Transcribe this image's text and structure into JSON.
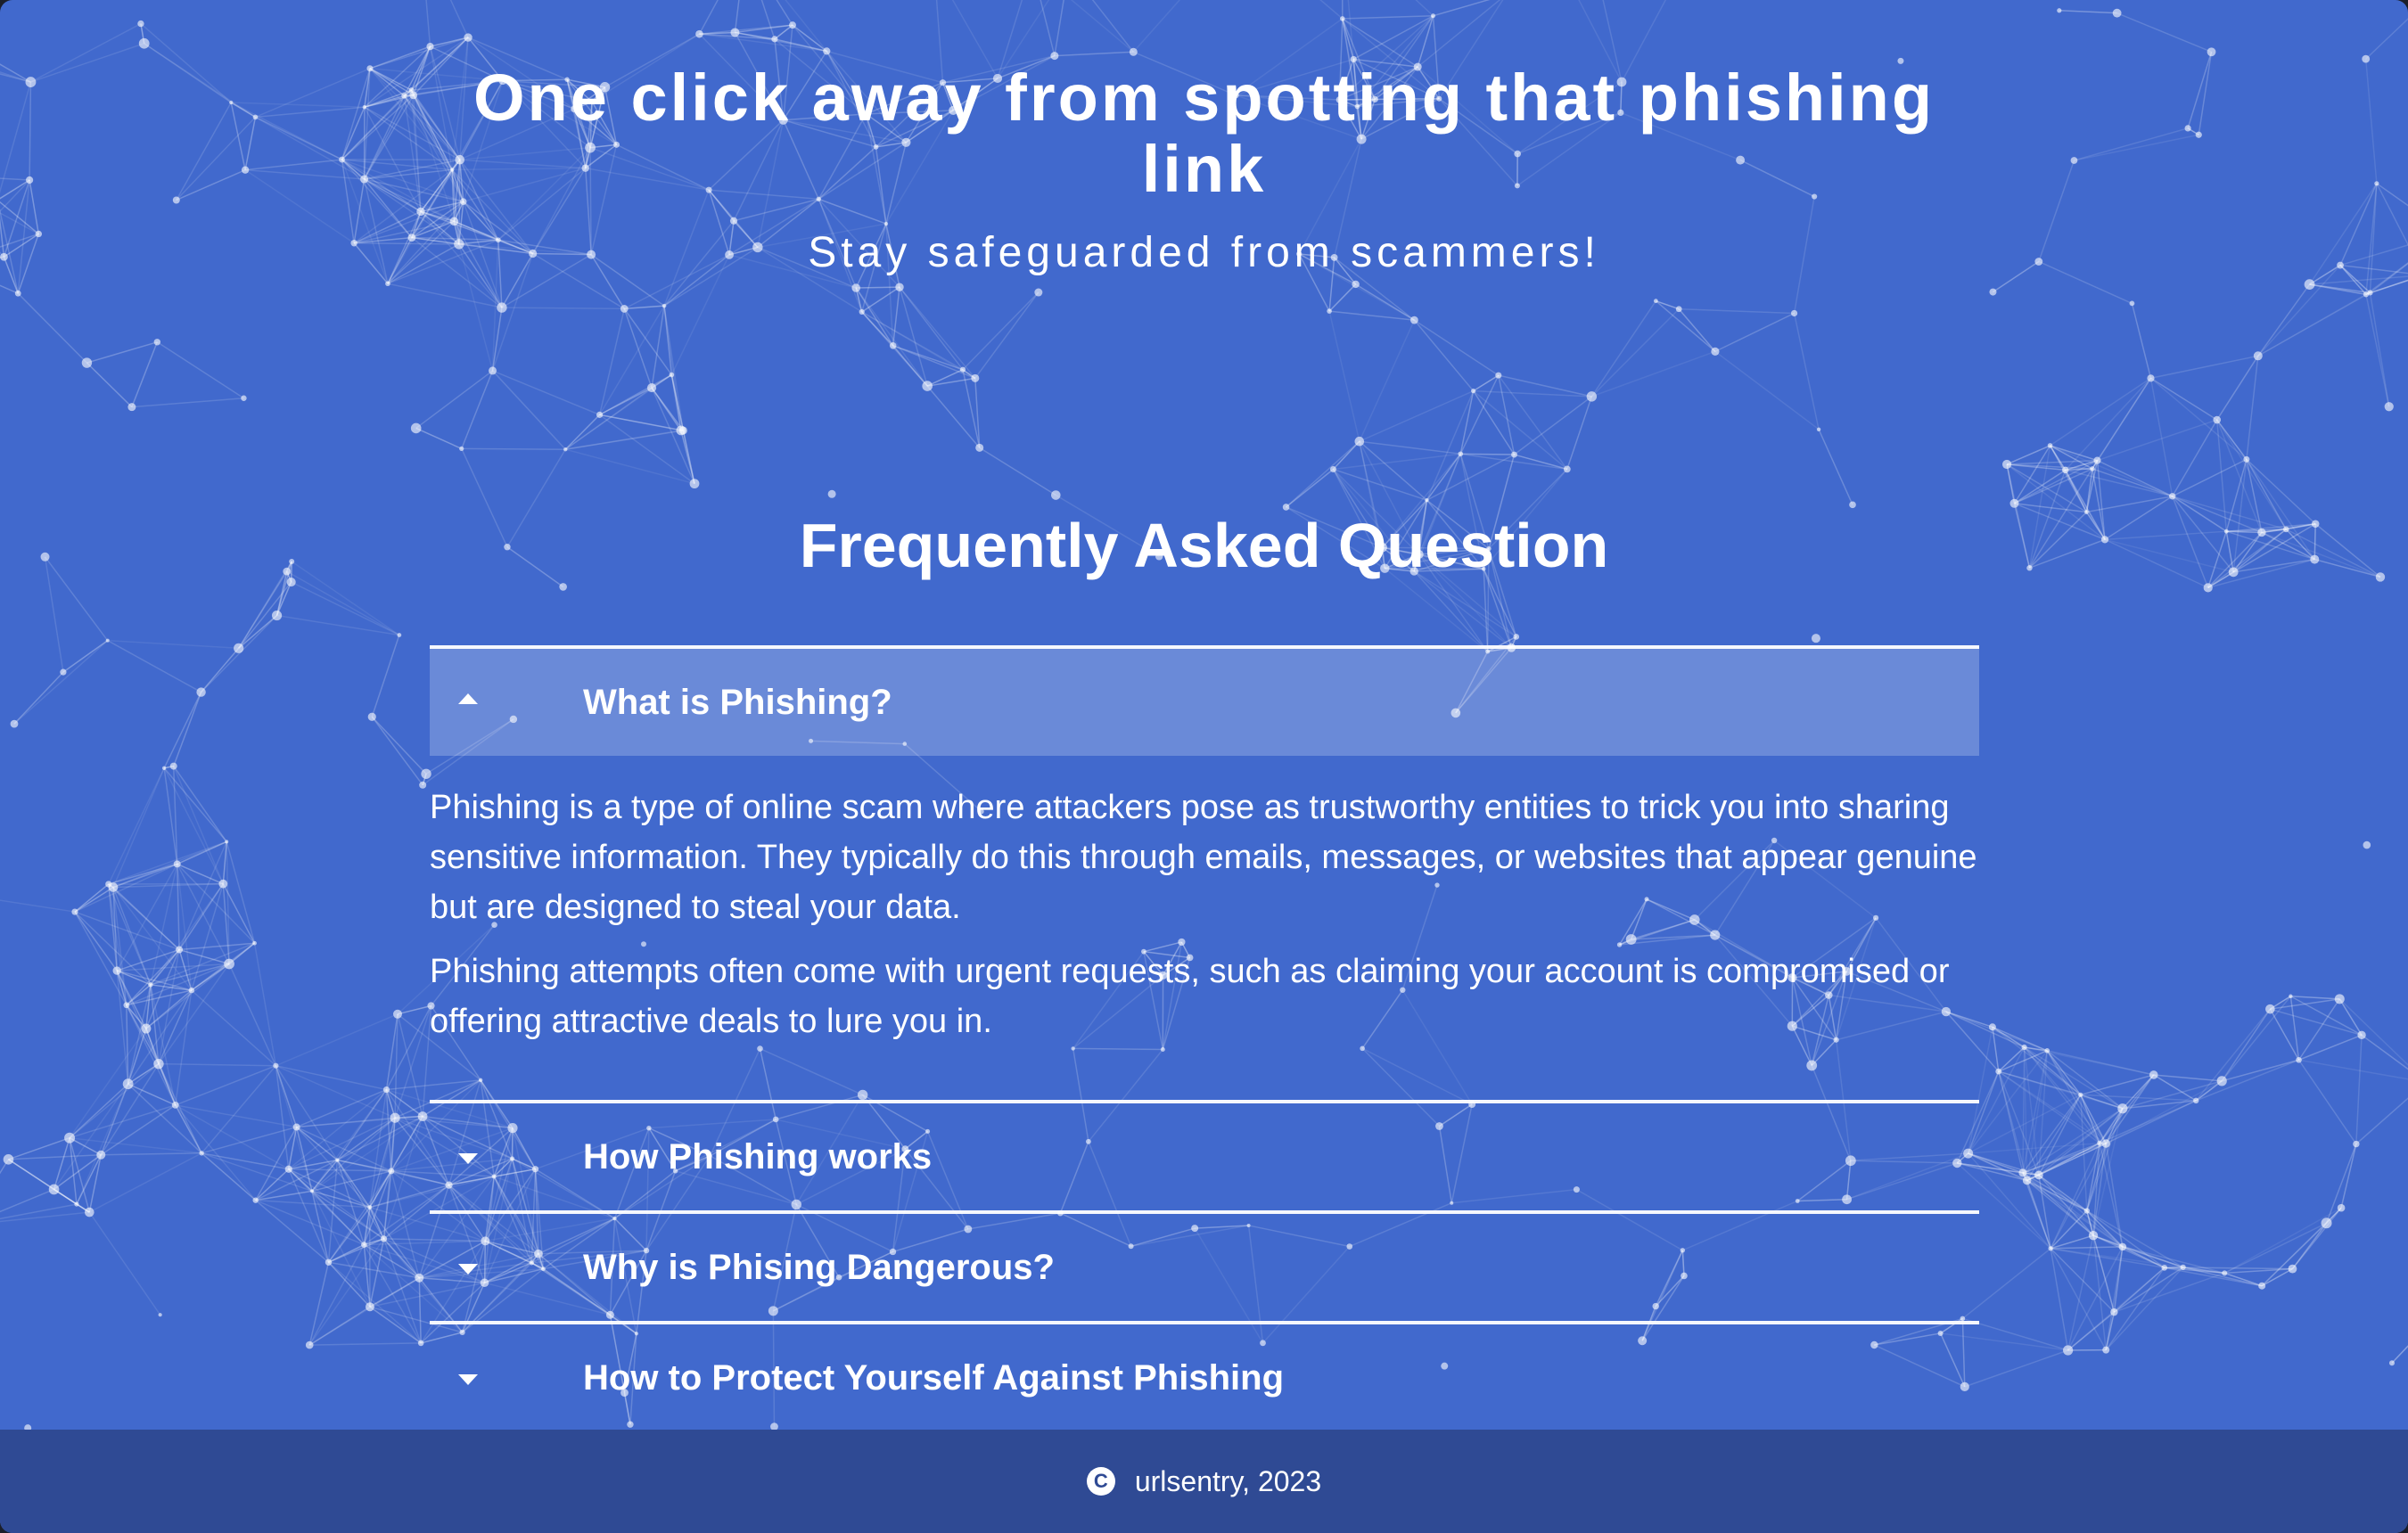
{
  "hero": {
    "title": "One click away from spotting that phishing link",
    "subtitle": "Stay safeguarded from scammers!"
  },
  "faq": {
    "heading": "Frequently Asked Question",
    "items": [
      {
        "question": "What is Phishing?",
        "expanded": true,
        "icon": "chevron-up-icon",
        "answer": [
          "Phishing is a type of online scam where attackers pose as trustworthy entities to trick you into sharing sensitive information. They typically do this through emails, messages, or websites that appear genuine but are designed to steal your data.",
          "Phishing attempts often come with urgent requests, such as claiming your account is compromised or offering attractive deals to lure you in."
        ]
      },
      {
        "question": "How Phishing works",
        "expanded": false,
        "icon": "chevron-down-icon"
      },
      {
        "question": "Why is Phising Dangerous?",
        "expanded": false,
        "icon": "chevron-down-icon"
      },
      {
        "question": "How to Protect Yourself Against Phishing",
        "expanded": false,
        "icon": "chevron-down-icon"
      }
    ]
  },
  "footer": {
    "copyright_symbol": "C",
    "text": "urlsentry, 2023"
  },
  "colors": {
    "background": "#4169cd",
    "footer": "#2f4a94",
    "text": "#ffffff"
  }
}
